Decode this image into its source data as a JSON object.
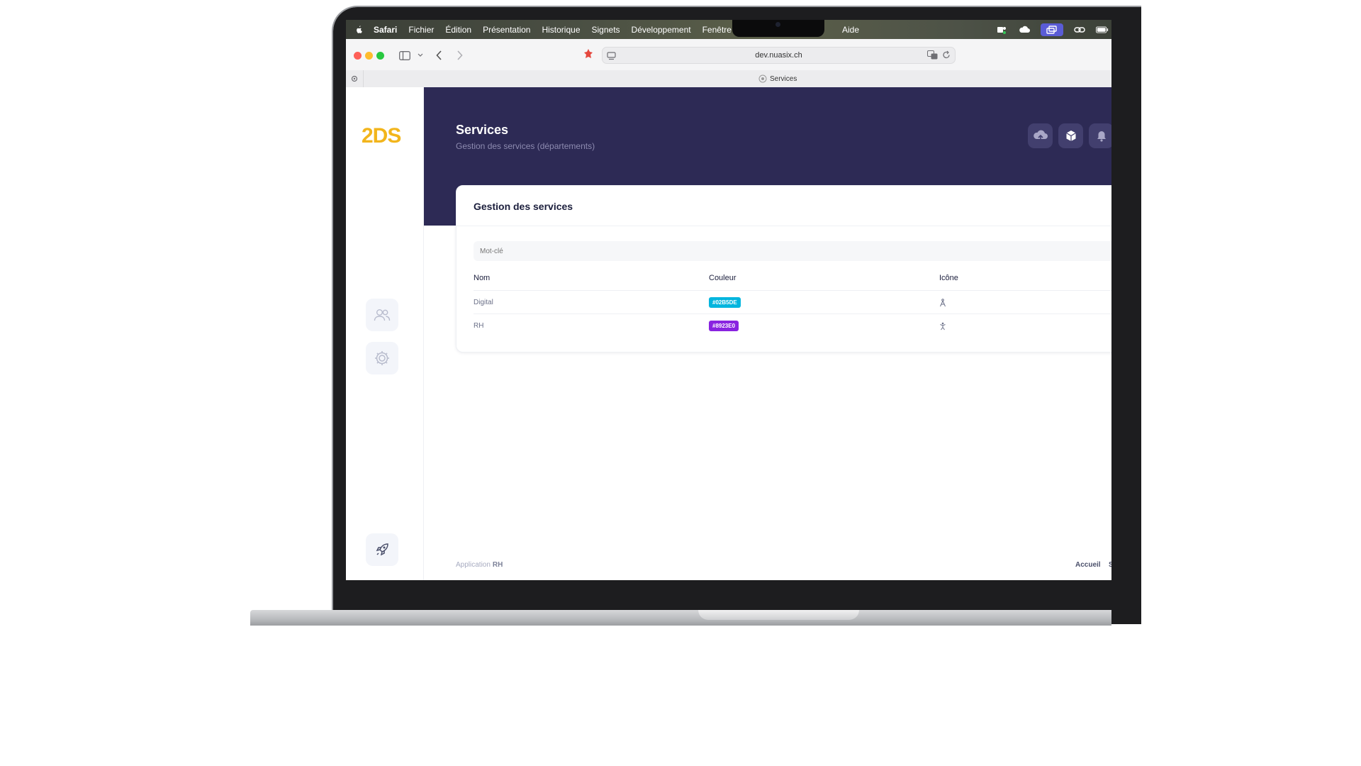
{
  "menubar": {
    "app_name": "Safari",
    "items": [
      "Fichier",
      "Édition",
      "Présentation",
      "Historique",
      "Signets",
      "Développement",
      "Fenêtre"
    ],
    "help": "Aide"
  },
  "browser": {
    "url": "dev.nuasix.ch",
    "tab_title": "Services"
  },
  "sidebar": {
    "logo": "2DS",
    "nav": [
      "users-icon",
      "gear-icon"
    ],
    "bottom": "rocket-icon"
  },
  "header": {
    "title": "Services",
    "subtitle": "Gestion des services (départements)",
    "actions": [
      "cloud-upload-icon",
      "cube-icon",
      "bell-icon"
    ]
  },
  "card": {
    "title": "Gestion des services",
    "search_placeholder": "Mot-clé",
    "columns": [
      "Nom",
      "Couleur",
      "Icône"
    ],
    "rows": [
      {
        "name": "Digital",
        "color": "#02B5DE",
        "icon": "compass-icon"
      },
      {
        "name": "RH",
        "color": "#8923E0",
        "icon": "person-icon"
      }
    ]
  },
  "footer": {
    "app_label": "Application",
    "app_name": "RH",
    "link": "Accueil",
    "link_cut": "S"
  },
  "colors": {
    "header_bg": "#2d2a55",
    "logo": "#f2b51c",
    "badge_digital": "#02B5DE",
    "badge_rh": "#8923E0"
  }
}
